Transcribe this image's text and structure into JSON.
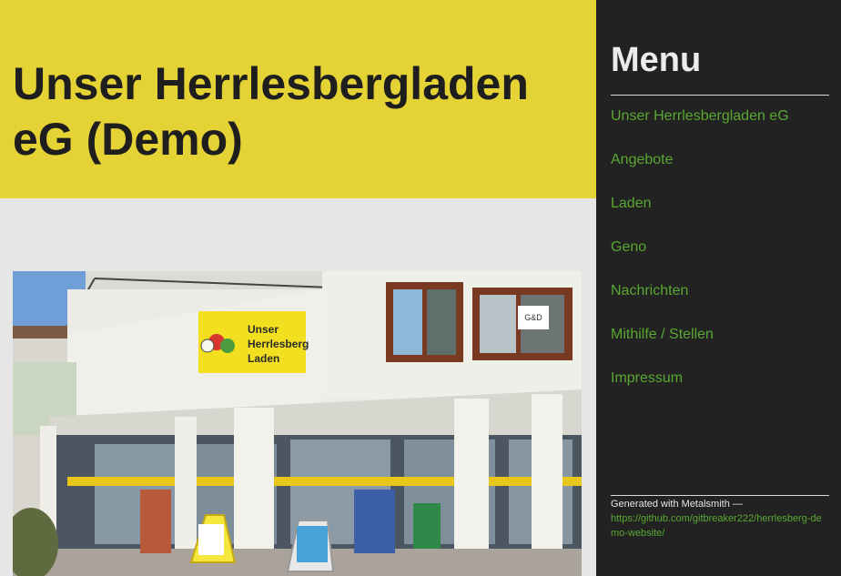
{
  "header": {
    "title": "Unser Herrlesbergladen eG (Demo)"
  },
  "photo": {
    "sign_lines": [
      "Unser",
      "Herrlesberg",
      "Laden"
    ],
    "window_sticker": "G&D"
  },
  "sidebar": {
    "title": "Menu",
    "items": [
      {
        "label": "Unser Herrlesbergladen eG"
      },
      {
        "label": "Angebote"
      },
      {
        "label": "Laden"
      },
      {
        "label": "Geno"
      },
      {
        "label": "Nachrichten"
      },
      {
        "label": "Mithilfe / Stellen"
      },
      {
        "label": "Impressum"
      }
    ],
    "footer_text": "Generated with Metalsmith —",
    "footer_link": "https://github.com/gitbreaker222/herrlesberg-demo-website/"
  },
  "colors": {
    "header_bg": "#e5d234",
    "sidebar_bg": "#222222",
    "link": "#5aa832",
    "page_bg": "#e6e6e6"
  }
}
